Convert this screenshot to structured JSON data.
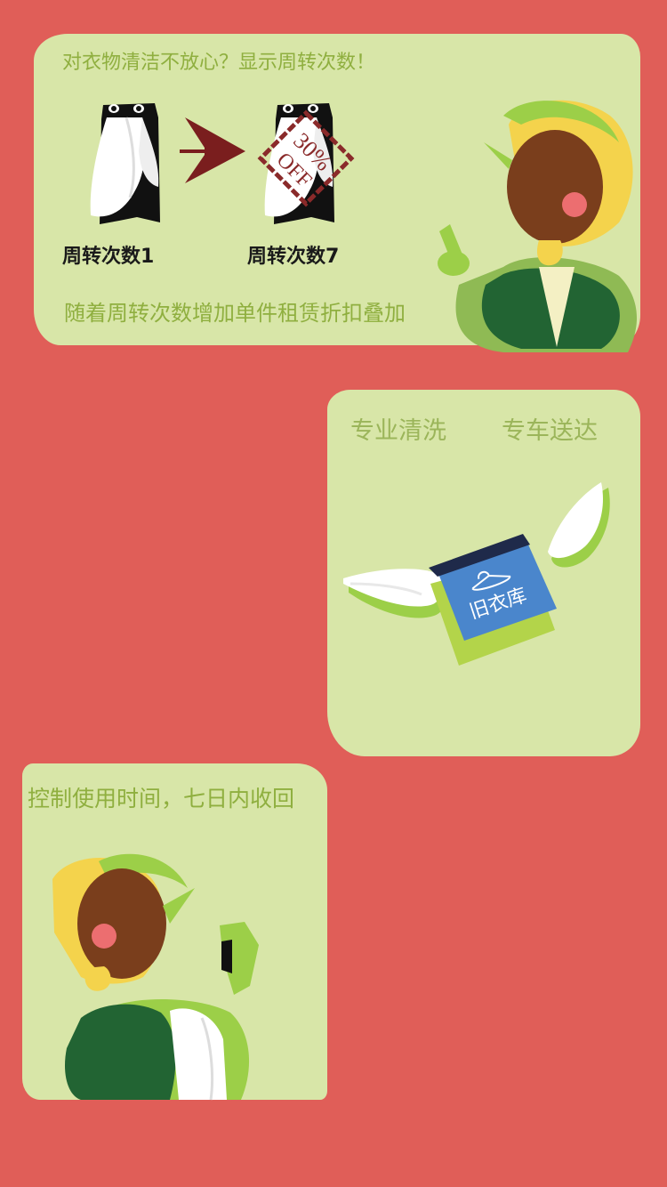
{
  "panel1": {
    "headline": "对衣物清洁不放心？显示周转次数！",
    "label_before": "周转次数1",
    "label_after": "周转次数7",
    "stamp_top": "30%",
    "stamp_bottom": "OFF",
    "footer": "随着周转次数增加单件租赁折扣叠加"
  },
  "panel2": {
    "service_clean": "专业清洗",
    "service_delivery": "专车送达",
    "brand_logo_text": "旧衣库"
  },
  "panel3": {
    "caption": "控制使用时间，七日内收回"
  },
  "colors": {
    "background": "#e05e58",
    "panel": "#d8e6a8",
    "accent_green": "#8faf3f",
    "dark_green": "#226433",
    "box_blue": "#4a86cc",
    "arrow_red": "#7a1e1e"
  }
}
